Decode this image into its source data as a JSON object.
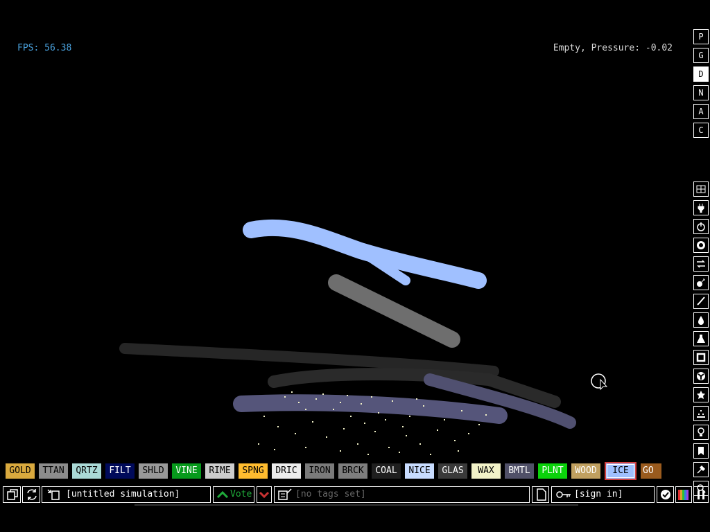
{
  "hud": {
    "fps": "FPS: 56.38",
    "status": "Empty, Pressure: -0.02"
  },
  "side_menu": [
    {
      "label": "P",
      "active": false
    },
    {
      "label": "G",
      "active": false
    },
    {
      "label": "D",
      "active": true
    },
    {
      "label": "N",
      "active": false
    },
    {
      "label": "A",
      "active": false
    },
    {
      "label": "C",
      "active": false
    }
  ],
  "category_icons": [
    "wall-icon",
    "plug-icon",
    "power-icon",
    "sensor-icon",
    "force-icon",
    "explosive-icon",
    "brush-icon",
    "liquid-icon",
    "gas-icon",
    "solid-icon",
    "radioactive-icon",
    "star-icon",
    "powders-icon",
    "bulb-icon",
    "bookmark-icon",
    "tools-icon",
    "search-icon"
  ],
  "elements": [
    {
      "name": "GOLD",
      "bg": "#d9a93e",
      "fg": "#000000"
    },
    {
      "name": "TTAN",
      "bg": "#8c8c8c",
      "fg": "#000000"
    },
    {
      "name": "QRTZ",
      "bg": "#aad9d6",
      "fg": "#000000"
    },
    {
      "name": "FILT",
      "bg": "#000a5a",
      "fg": "#ffffff"
    },
    {
      "name": "SHLD",
      "bg": "#999999",
      "fg": "#000000"
    },
    {
      "name": "VINE",
      "bg": "#079a1c",
      "fg": "#ffffff"
    },
    {
      "name": "RIME",
      "bg": "#cccccc",
      "fg": "#000000"
    },
    {
      "name": "SPNG",
      "bg": "#ffbc2f",
      "fg": "#000000"
    },
    {
      "name": "DRIC",
      "bg": "#ececec",
      "fg": "#000000"
    },
    {
      "name": "IRON",
      "bg": "#7a7a7a",
      "fg": "#000000"
    },
    {
      "name": "BRCK",
      "bg": "#7e7e7e",
      "fg": "#000000"
    },
    {
      "name": "COAL",
      "bg": "#1f1f1f",
      "fg": "#ffffff"
    },
    {
      "name": "NICE",
      "bg": "#c8dcff",
      "fg": "#000000"
    },
    {
      "name": "GLAS",
      "bg": "#3a3a3a",
      "fg": "#ffffff"
    },
    {
      "name": "WAX",
      "bg": "#f2f2c8",
      "fg": "#000000"
    },
    {
      "name": "BMTL",
      "bg": "#505068",
      "fg": "#ffffff"
    },
    {
      "name": "PLNT",
      "bg": "#0bd20b",
      "fg": "#ffffff"
    },
    {
      "name": "WOOD",
      "bg": "#c0a060",
      "fg": "#ffffff"
    },
    {
      "name": "ICE",
      "bg": "#a0c0ff",
      "fg": "#000000",
      "selected": true
    },
    {
      "name": "GO",
      "bg": "#9a5b1e",
      "fg": "#ffffff"
    }
  ],
  "bottom": {
    "sim_title": "[untitled simulation]",
    "vote_label": "Vote",
    "tags": "[no tags set]",
    "sign_in": "[sign in]"
  }
}
